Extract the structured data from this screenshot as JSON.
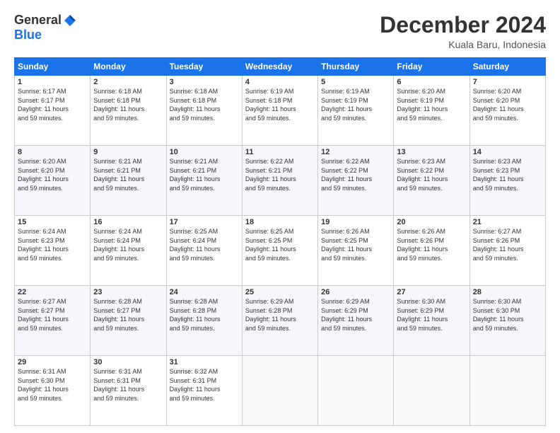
{
  "logo": {
    "general": "General",
    "blue": "Blue"
  },
  "title": {
    "month_year": "December 2024",
    "location": "Kuala Baru, Indonesia"
  },
  "weekdays": [
    "Sunday",
    "Monday",
    "Tuesday",
    "Wednesday",
    "Thursday",
    "Friday",
    "Saturday"
  ],
  "weeks": [
    [
      {
        "day": "1",
        "info": "Sunrise: 6:17 AM\nSunset: 6:17 PM\nDaylight: 11 hours\nand 59 minutes."
      },
      {
        "day": "2",
        "info": "Sunrise: 6:18 AM\nSunset: 6:18 PM\nDaylight: 11 hours\nand 59 minutes."
      },
      {
        "day": "3",
        "info": "Sunrise: 6:18 AM\nSunset: 6:18 PM\nDaylight: 11 hours\nand 59 minutes."
      },
      {
        "day": "4",
        "info": "Sunrise: 6:19 AM\nSunset: 6:18 PM\nDaylight: 11 hours\nand 59 minutes."
      },
      {
        "day": "5",
        "info": "Sunrise: 6:19 AM\nSunset: 6:19 PM\nDaylight: 11 hours\nand 59 minutes."
      },
      {
        "day": "6",
        "info": "Sunrise: 6:20 AM\nSunset: 6:19 PM\nDaylight: 11 hours\nand 59 minutes."
      },
      {
        "day": "7",
        "info": "Sunrise: 6:20 AM\nSunset: 6:20 PM\nDaylight: 11 hours\nand 59 minutes."
      }
    ],
    [
      {
        "day": "8",
        "info": "Sunrise: 6:20 AM\nSunset: 6:20 PM\nDaylight: 11 hours\nand 59 minutes."
      },
      {
        "day": "9",
        "info": "Sunrise: 6:21 AM\nSunset: 6:21 PM\nDaylight: 11 hours\nand 59 minutes."
      },
      {
        "day": "10",
        "info": "Sunrise: 6:21 AM\nSunset: 6:21 PM\nDaylight: 11 hours\nand 59 minutes."
      },
      {
        "day": "11",
        "info": "Sunrise: 6:22 AM\nSunset: 6:21 PM\nDaylight: 11 hours\nand 59 minutes."
      },
      {
        "day": "12",
        "info": "Sunrise: 6:22 AM\nSunset: 6:22 PM\nDaylight: 11 hours\nand 59 minutes."
      },
      {
        "day": "13",
        "info": "Sunrise: 6:23 AM\nSunset: 6:22 PM\nDaylight: 11 hours\nand 59 minutes."
      },
      {
        "day": "14",
        "info": "Sunrise: 6:23 AM\nSunset: 6:23 PM\nDaylight: 11 hours\nand 59 minutes."
      }
    ],
    [
      {
        "day": "15",
        "info": "Sunrise: 6:24 AM\nSunset: 6:23 PM\nDaylight: 11 hours\nand 59 minutes."
      },
      {
        "day": "16",
        "info": "Sunrise: 6:24 AM\nSunset: 6:24 PM\nDaylight: 11 hours\nand 59 minutes."
      },
      {
        "day": "17",
        "info": "Sunrise: 6:25 AM\nSunset: 6:24 PM\nDaylight: 11 hours\nand 59 minutes."
      },
      {
        "day": "18",
        "info": "Sunrise: 6:25 AM\nSunset: 6:25 PM\nDaylight: 11 hours\nand 59 minutes."
      },
      {
        "day": "19",
        "info": "Sunrise: 6:26 AM\nSunset: 6:25 PM\nDaylight: 11 hours\nand 59 minutes."
      },
      {
        "day": "20",
        "info": "Sunrise: 6:26 AM\nSunset: 6:26 PM\nDaylight: 11 hours\nand 59 minutes."
      },
      {
        "day": "21",
        "info": "Sunrise: 6:27 AM\nSunset: 6:26 PM\nDaylight: 11 hours\nand 59 minutes."
      }
    ],
    [
      {
        "day": "22",
        "info": "Sunrise: 6:27 AM\nSunset: 6:27 PM\nDaylight: 11 hours\nand 59 minutes."
      },
      {
        "day": "23",
        "info": "Sunrise: 6:28 AM\nSunset: 6:27 PM\nDaylight: 11 hours\nand 59 minutes."
      },
      {
        "day": "24",
        "info": "Sunrise: 6:28 AM\nSunset: 6:28 PM\nDaylight: 11 hours\nand 59 minutes."
      },
      {
        "day": "25",
        "info": "Sunrise: 6:29 AM\nSunset: 6:28 PM\nDaylight: 11 hours\nand 59 minutes."
      },
      {
        "day": "26",
        "info": "Sunrise: 6:29 AM\nSunset: 6:29 PM\nDaylight: 11 hours\nand 59 minutes."
      },
      {
        "day": "27",
        "info": "Sunrise: 6:30 AM\nSunset: 6:29 PM\nDaylight: 11 hours\nand 59 minutes."
      },
      {
        "day": "28",
        "info": "Sunrise: 6:30 AM\nSunset: 6:30 PM\nDaylight: 11 hours\nand 59 minutes."
      }
    ],
    [
      {
        "day": "29",
        "info": "Sunrise: 6:31 AM\nSunset: 6:30 PM\nDaylight: 11 hours\nand 59 minutes."
      },
      {
        "day": "30",
        "info": "Sunrise: 6:31 AM\nSunset: 6:31 PM\nDaylight: 11 hours\nand 59 minutes."
      },
      {
        "day": "31",
        "info": "Sunrise: 6:32 AM\nSunset: 6:31 PM\nDaylight: 11 hours\nand 59 minutes."
      },
      null,
      null,
      null,
      null
    ]
  ]
}
